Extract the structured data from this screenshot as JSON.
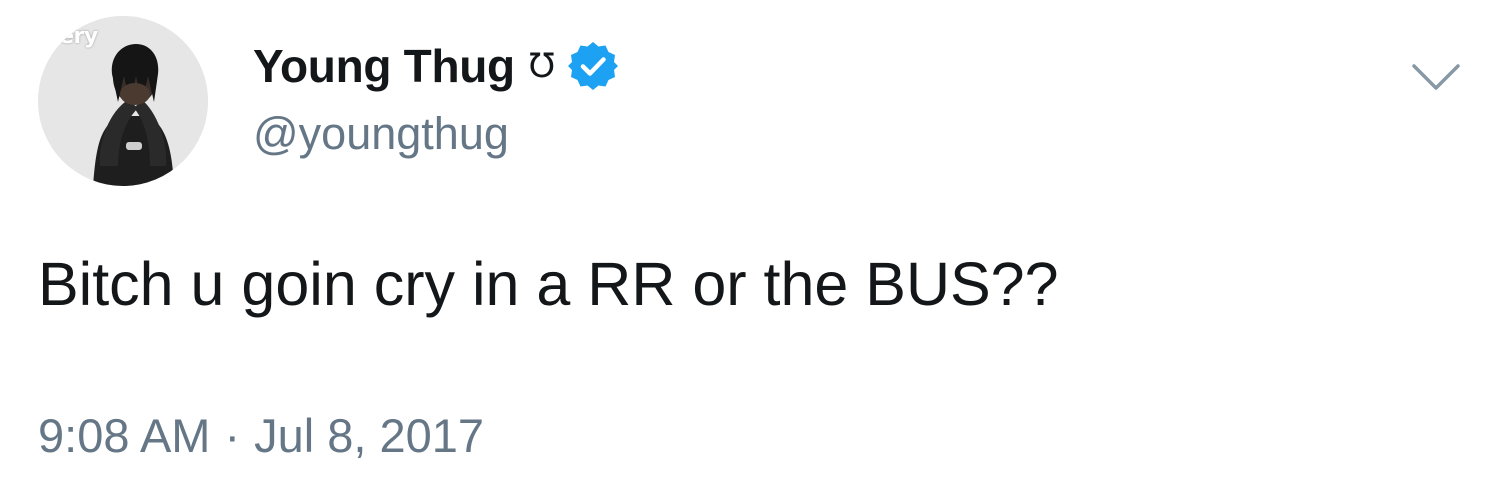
{
  "tweet": {
    "avatar_watermark": "fery",
    "display_name": "Young Thug",
    "name_emoji": "Ʊ",
    "handle": "@youngthug",
    "text": "Bitch u goin cry in a RR or the BUS??",
    "time": "9:08 AM",
    "separator": "·",
    "date": "Jul 8, 2017"
  },
  "icons": {
    "verified": "verified-badge-icon",
    "menu": "chevron-down-icon"
  },
  "colors": {
    "verified_blue": "#1da1f2",
    "text_primary": "#14171a",
    "text_secondary": "#657786",
    "background": "#ffffff"
  }
}
